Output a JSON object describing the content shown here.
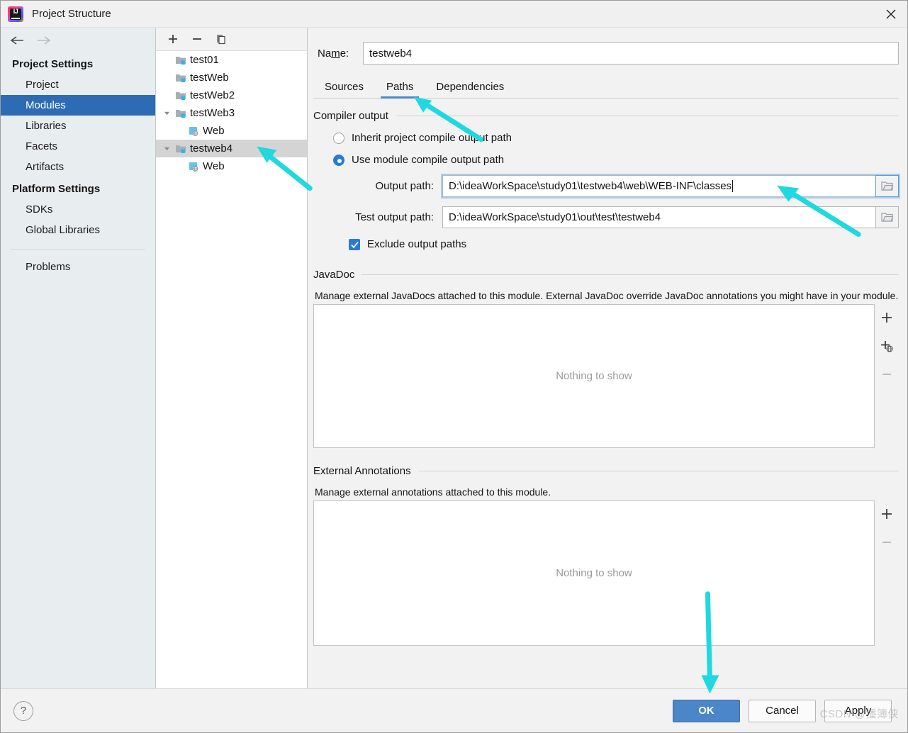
{
  "window": {
    "title": "Project Structure",
    "app_icon": "intellij-idea-icon",
    "close_icon": "close-icon"
  },
  "sidebar": {
    "back_icon": "arrow-left-icon",
    "forward_icon": "arrow-right-icon",
    "groups": [
      {
        "title": "Project Settings",
        "items": [
          {
            "label": "Project",
            "selected": false
          },
          {
            "label": "Modules",
            "selected": true
          },
          {
            "label": "Libraries",
            "selected": false
          },
          {
            "label": "Facets",
            "selected": false
          },
          {
            "label": "Artifacts",
            "selected": false
          }
        ]
      },
      {
        "title": "Platform Settings",
        "items": [
          {
            "label": "SDKs",
            "selected": false
          },
          {
            "label": "Global Libraries",
            "selected": false
          }
        ]
      }
    ],
    "problems_label": "Problems"
  },
  "tree": {
    "toolbar": [
      {
        "name": "add-module-button",
        "icon": "plus-icon"
      },
      {
        "name": "remove-module-button",
        "icon": "minus-icon"
      },
      {
        "name": "copy-module-button",
        "icon": "copy-icon"
      }
    ],
    "rows": [
      {
        "label": "test01",
        "icon": "module-folder-icon",
        "indent": 1,
        "twisty": "none",
        "selected": false
      },
      {
        "label": "testWeb",
        "icon": "module-folder-icon",
        "indent": 1,
        "twisty": "none",
        "selected": false
      },
      {
        "label": "testWeb2",
        "icon": "module-folder-icon",
        "indent": 1,
        "twisty": "none",
        "selected": false
      },
      {
        "label": "testWeb3",
        "icon": "module-folder-icon",
        "indent": 0,
        "twisty": "expanded",
        "selected": false
      },
      {
        "label": "Web",
        "icon": "web-facet-icon",
        "indent": 2,
        "twisty": "none",
        "selected": false
      },
      {
        "label": "testweb4",
        "icon": "module-folder-icon",
        "indent": 0,
        "twisty": "expanded",
        "selected": true
      },
      {
        "label": "Web",
        "icon": "web-facet-icon",
        "indent": 2,
        "twisty": "none",
        "selected": false
      }
    ]
  },
  "main": {
    "name_label_pre": "Na",
    "name_label_mnemonic": "m",
    "name_label_post": "e:",
    "name_value": "testweb4",
    "tabs": [
      {
        "label": "Sources",
        "active": false
      },
      {
        "label": "Paths",
        "active": true
      },
      {
        "label": "Dependencies",
        "active": false
      }
    ],
    "compiler_output": {
      "section_title": "Compiler output",
      "inherit_label": "Inherit project compile output path",
      "inherit_checked": false,
      "module_label": "Use module compile output path",
      "module_checked": true,
      "output_path_label": "Output path:",
      "output_path_value": "D:\\ideaWorkSpace\\study01\\testweb4\\web\\WEB-INF\\classes",
      "test_output_path_label": "Test output path:",
      "test_output_path_value": "D:\\ideaWorkSpace\\study01\\out\\test\\testweb4",
      "exclude_label": "Exclude output paths",
      "exclude_checked": true,
      "browse_icon": "folder-open-icon"
    },
    "javadoc": {
      "section_title": "JavaDoc",
      "description": "Manage external JavaDocs attached to this module. External JavaDoc override JavaDoc annotations you might have in your module.",
      "empty_text": "Nothing to show",
      "buttons": [
        {
          "name": "javadoc-add-button",
          "icon": "plus-icon",
          "disabled": false
        },
        {
          "name": "javadoc-add-url-button",
          "icon": "plus-globe-icon",
          "disabled": false
        },
        {
          "name": "javadoc-remove-button",
          "icon": "minus-icon",
          "disabled": true
        }
      ]
    },
    "external_annotations": {
      "section_title": "External Annotations",
      "description": "Manage external annotations attached to this module.",
      "empty_text": "Nothing to show",
      "buttons": [
        {
          "name": "annotations-add-button",
          "icon": "plus-icon",
          "disabled": false
        },
        {
          "name": "annotations-remove-button",
          "icon": "minus-icon",
          "disabled": true
        }
      ]
    }
  },
  "footer": {
    "help_label": "?",
    "ok_label": "OK",
    "cancel_label": "Cancel",
    "apply_label": "Apply"
  },
  "watermark": "CSDN @播簿侠",
  "colors": {
    "accent_blue": "#2d6cb5",
    "tab_underline": "#4a88c7",
    "ok_button": "#4a86c8",
    "annotation_arrow": "#1fd8e0",
    "selection_gray": "#d4d4d4"
  },
  "annotations": [
    {
      "name": "arrow-to-paths-tab",
      "color": "#1fd8e0"
    },
    {
      "name": "arrow-to-testweb4-module",
      "color": "#1fd8e0"
    },
    {
      "name": "arrow-to-output-path-field",
      "color": "#1fd8e0"
    },
    {
      "name": "arrow-to-ok-button",
      "color": "#1fd8e0"
    }
  ]
}
